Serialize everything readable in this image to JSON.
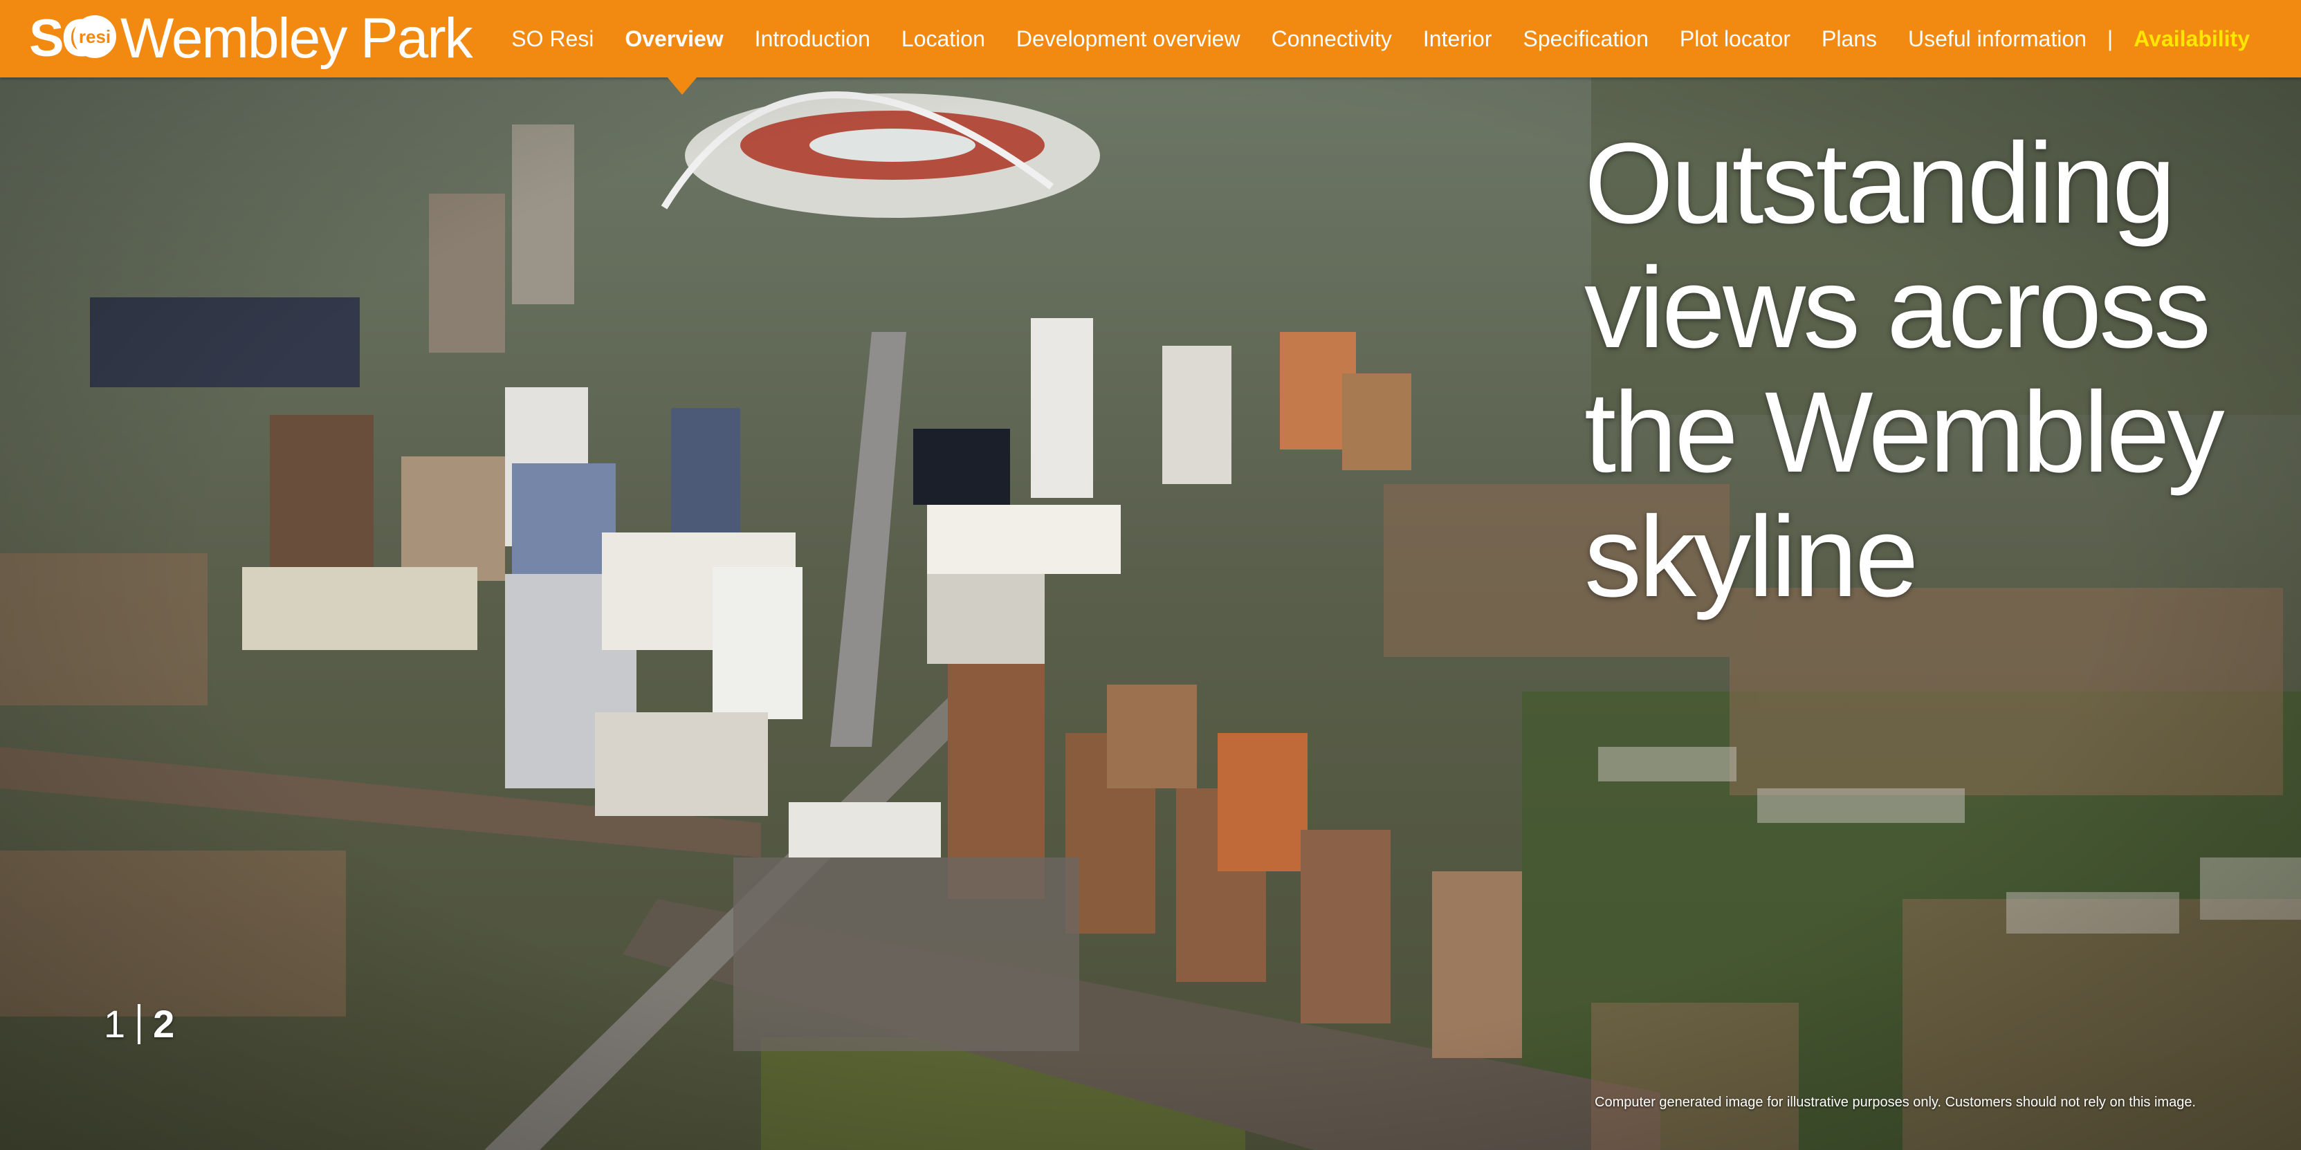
{
  "brand": {
    "so": "SO",
    "badge": "resi",
    "name": "Wembley Park"
  },
  "nav": {
    "items": [
      {
        "label": "SO Resi"
      },
      {
        "label": "Overview"
      },
      {
        "label": "Introduction"
      },
      {
        "label": "Location"
      },
      {
        "label": "Development overview"
      },
      {
        "label": "Connectivity"
      },
      {
        "label": "Interior"
      },
      {
        "label": "Specification"
      },
      {
        "label": "Plot locator"
      },
      {
        "label": "Plans"
      },
      {
        "label": "Useful information"
      }
    ],
    "active": "Overview",
    "separator": "|",
    "availability": "Availability"
  },
  "hero": {
    "headline": "Outstanding views across the Wembley skyline"
  },
  "pager": {
    "prev": "1",
    "current": "2"
  },
  "disclaimer": "Computer generated image for illustrative purposes only. Customers should not rely on this image.",
  "colors": {
    "nav_background": "#f28a12",
    "availability": "#ffe500",
    "text": "#ffffff"
  }
}
